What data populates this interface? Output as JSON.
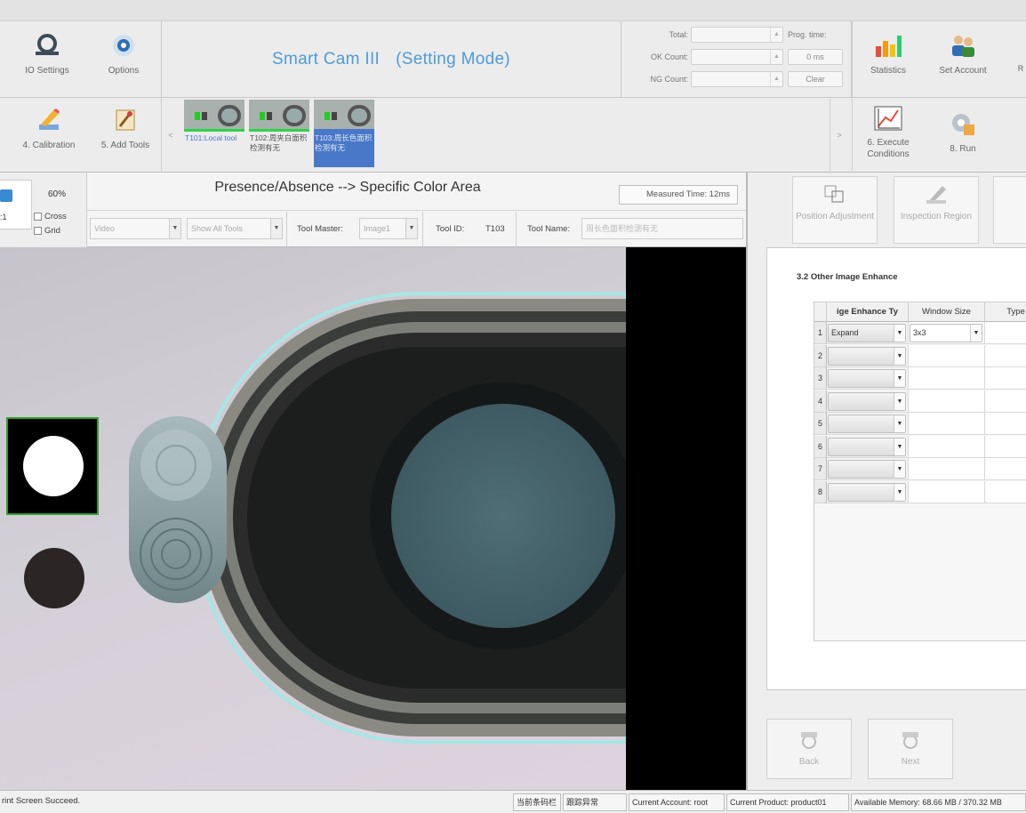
{
  "app": {
    "title": "Smart Cam III",
    "mode": "(Setting Mode)"
  },
  "toolbar_top": [
    {
      "label": "IO Settings",
      "icon": "io-settings-icon"
    },
    {
      "label": "Options",
      "icon": "options-icon"
    },
    {
      "label": "Statistics",
      "icon": "statistics-icon"
    },
    {
      "label": "Set Account",
      "icon": "set-account-icon"
    }
  ],
  "counts": {
    "total_label": "Total:",
    "ok_label": "OK Count:",
    "ng_label": "NG Count:",
    "prog_label": "Prog. time:",
    "prog_value": "0 ms",
    "clear_label": "Clear"
  },
  "toolbar_bottom": [
    {
      "label": "4. Calibration",
      "icon": "calibration-icon"
    },
    {
      "label": "5. Add Tools",
      "icon": "add-tools-icon"
    },
    {
      "label": "6. Execute Conditions",
      "icon": "execute-conditions-icon"
    },
    {
      "label": "8. Run",
      "icon": "run-icon"
    }
  ],
  "tools": [
    {
      "label": "T101:Local tool",
      "selected": false
    },
    {
      "label": "T102:周夹白面积检测有无",
      "selected": false
    },
    {
      "label": "T103:周长色面积检测有无",
      "selected": true
    }
  ],
  "nav": {
    "prev": "<",
    "next": ">"
  },
  "view": {
    "zoom": "60%",
    "ratio": ":1",
    "cross_label": "Cross",
    "grid_label": "Grid"
  },
  "inspection": {
    "title": "Presence/Absence --> Specific Color Area",
    "measured_time": "Measured Time: 12ms",
    "video_value": "Video",
    "show_tools_value": "Show All Tools",
    "tool_master_label": "Tool Master:",
    "tool_master_value": "Image1",
    "tool_id_label": "Tool ID:",
    "tool_id_value": "T103",
    "tool_name_label": "Tool Name:",
    "tool_name_value": "周长色面积检测有无"
  },
  "right_panel": {
    "tools": [
      {
        "label": "Position Adjustment",
        "icon": "position-adjustment-icon"
      },
      {
        "label": "Inspection Region",
        "icon": "inspection-region-icon"
      }
    ],
    "section_title": "3.2 Other Image Enhance",
    "grid_headers": [
      "ige Enhance Ty",
      "Window Size",
      "Type"
    ],
    "rows": [
      {
        "n": "1",
        "enhance": "Expand",
        "window": "3x3"
      },
      {
        "n": "2",
        "enhance": "",
        "window": ""
      },
      {
        "n": "3",
        "enhance": "",
        "window": ""
      },
      {
        "n": "4",
        "enhance": "",
        "window": ""
      },
      {
        "n": "5",
        "enhance": "",
        "window": ""
      },
      {
        "n": "6",
        "enhance": "",
        "window": ""
      },
      {
        "n": "7",
        "enhance": "",
        "window": ""
      },
      {
        "n": "8",
        "enhance": "",
        "window": ""
      }
    ],
    "back_label": "Back",
    "next_label": "Next"
  },
  "status": {
    "message": "rint Screen Succeed.",
    "f1": "当前条码栏",
    "f2": "跟踪异常",
    "account": "Current Account: root",
    "product": "Current Product: product01",
    "memory": "Available Memory: 68.66 MB / 370.32 MB"
  },
  "colors": {
    "title_blue": "#4f9ad8",
    "selected_tool": "#4a78c8",
    "green_bar": "#2fd24a"
  }
}
